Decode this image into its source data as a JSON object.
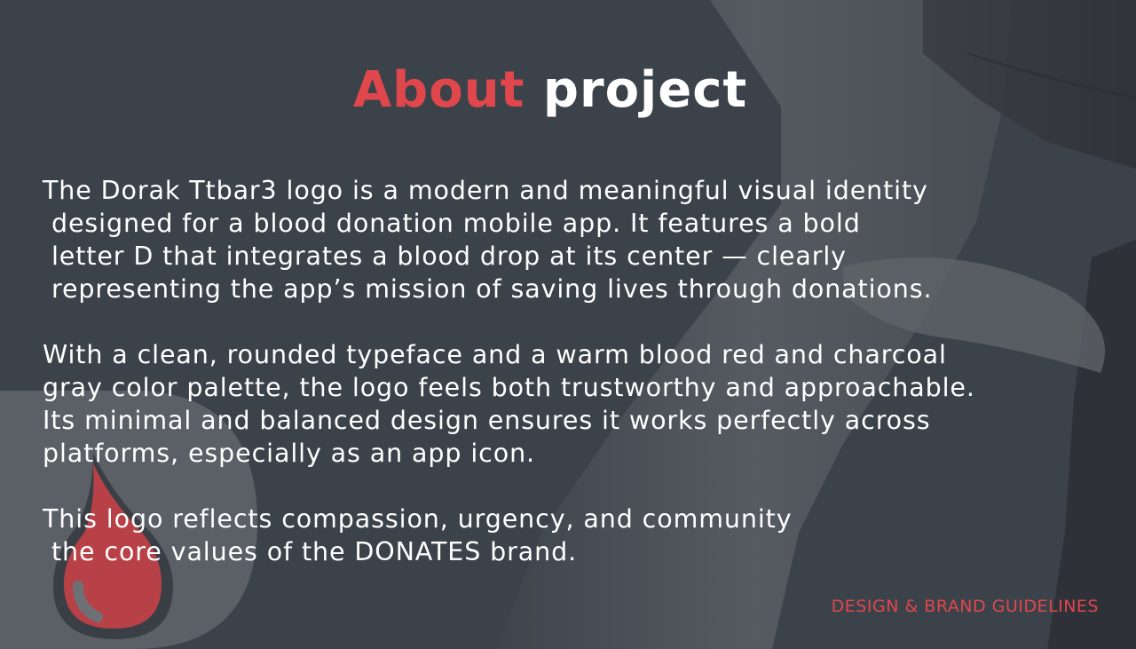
{
  "title": {
    "accent": "About",
    "rest": "project"
  },
  "paragraphs": [
    {
      "lines": [
        "The Dorak Ttbar3 logo is a modern and meaningful visual identity",
        " designed for a blood donation mobile app. It features a bold",
        " letter D that integrates a blood drop at its center — clearly",
        " representing the app’s mission of saving lives through donations."
      ]
    },
    {
      "lines": [
        "With a clean, rounded typeface and a warm blood red and charcoal",
        "gray color palette, the logo feels both trustworthy and approachable.",
        "Its minimal and balanced design ensures it works perfectly across",
        "platforms, especially as an app icon."
      ]
    },
    {
      "lines": [
        "This logo reflects compassion, urgency, and community",
        " the core values of the DONATES brand."
      ]
    }
  ],
  "footer": "DESIGN & BRAND GUIDELINES",
  "colors": {
    "accent": "#e0474d",
    "background": "#3c4249",
    "text": "#ffffff"
  },
  "icons": {
    "logo": "blood-drop-letter-d-logo",
    "background": "arm-blood-donation-photo"
  }
}
